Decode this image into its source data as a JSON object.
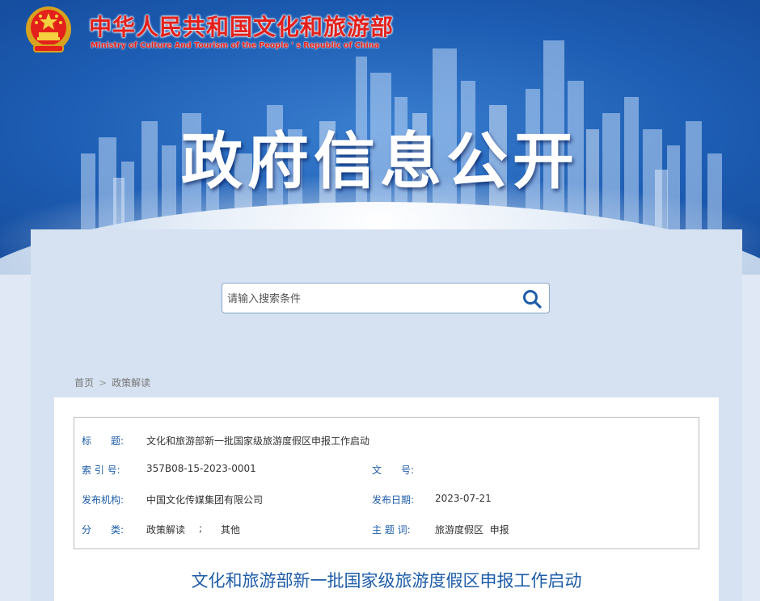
{
  "header": {
    "site_title": "中华人民共和国文化和旅游部",
    "site_subtitle": "Ministry of Culture And Tourism of the People ' s Republic of China",
    "logo_icon": "national-emblem-icon",
    "banner_title": "政府信息公开"
  },
  "search": {
    "placeholder": "请输入搜索条件",
    "button_icon": "search-icon"
  },
  "breadcrumb": {
    "items": [
      "首页",
      "政策解读"
    ],
    "separator": ">"
  },
  "info": {
    "title_label": "标　　题:",
    "title_value": "文化和旅游部新一批国家级旅游度假区申报工作启动",
    "index_label": "索 引 号:",
    "index_value": "357B08-15-2023-0001",
    "doc_no_label": "文　　号:",
    "doc_no_value": "",
    "publisher_label": "发布机构:",
    "publisher_value": "中国文化传媒集团有限公司",
    "date_label": "发布日期:",
    "date_value": "2023-07-21",
    "category_label": "分　　类:",
    "category_value_1": "政策解读",
    "category_sep": ";",
    "category_value_2": "其他",
    "keywords_label": "主 题 词:",
    "keywords_value": "旅游度假区  申报"
  },
  "article": {
    "title": "文化和旅游部新一批国家级旅游度假区申报工作启动"
  },
  "colors": {
    "brand_red": "#e3201b",
    "banner_blue": "#1d5db3",
    "label_blue": "#1d5ca8"
  }
}
